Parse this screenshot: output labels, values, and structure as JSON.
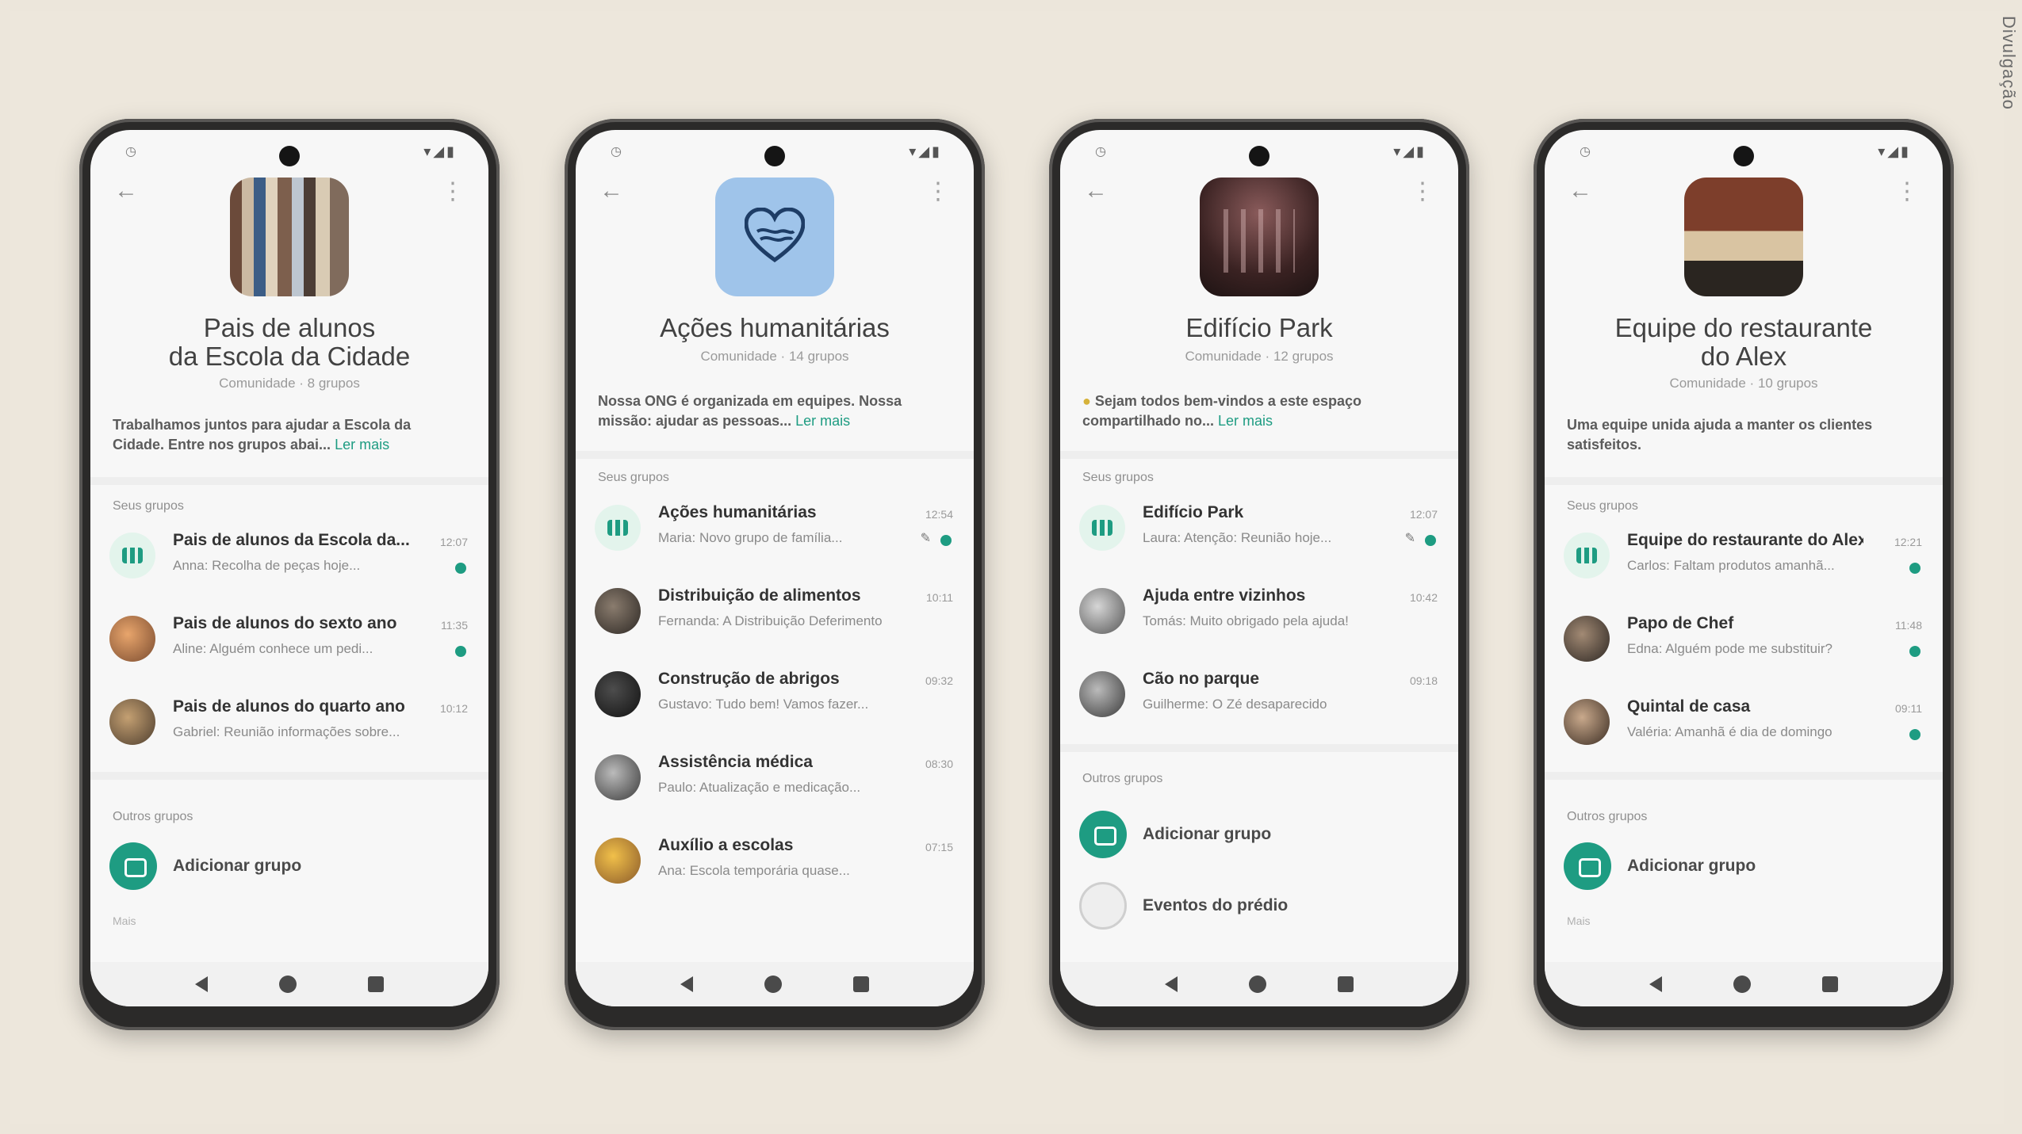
{
  "credit": "Divulgação",
  "accent_color": "#1e9c82",
  "phones": [
    {
      "title": "Pais de alunos\nda Escola da Cidade",
      "subtitle": "Comunidade · 8 grupos",
      "description": "Trabalhamos juntos para ajudar a Escola da Cidade. Entre nos grupos abai...",
      "more_link": "Ler mais",
      "groups_label": "Seus grupos",
      "groups": [
        {
          "name": "Pais de alunos da Escola da...",
          "preview": "Anna: Recolha de peças hoje...",
          "time": "12:07",
          "badge": true
        },
        {
          "name": "Pais de alunos do sexto ano",
          "preview": "Aline: Alguém conhece um pedi...",
          "time": "11:35",
          "badge": true
        },
        {
          "name": "Pais de alunos do quarto ano",
          "preview": "Gabriel: Reunião informações sobre...",
          "time": "10:12",
          "badge": false
        }
      ],
      "other_label": "Outros grupos",
      "add_group": "Adicionar grupo",
      "more_rows": "Mais"
    },
    {
      "title": "Ações humanitárias",
      "subtitle": "Comunidade · 14 grupos",
      "description": "Nossa ONG é organizada em equipes. Nossa missão: ajudar as pessoas...",
      "more_link": "Ler mais",
      "groups_label": "Seus grupos",
      "groups": [
        {
          "name": "Ações humanitárias",
          "preview": "Maria: Novo grupo de família...",
          "time": "12:54",
          "badge": true
        },
        {
          "name": "Distribuição de alimentos",
          "preview": "Fernanda: A Distribuição Deferimento",
          "time": "10:11",
          "badge": false
        },
        {
          "name": "Construção de abrigos",
          "preview": "Gustavo: Tudo bem! Vamos fazer...",
          "time": "09:32",
          "badge": false
        },
        {
          "name": "Assistência médica",
          "preview": "Paulo: Atualização e medicação...",
          "time": "08:30",
          "badge": false
        },
        {
          "name": "Auxílio a escolas",
          "preview": "Ana: Escola temporária quase...",
          "time": "07:15",
          "badge": false
        }
      ]
    },
    {
      "title": "Edifício Park",
      "subtitle": "Comunidade · 12 grupos",
      "description": "Sejam todos bem-vindos a este espaço compartilhado no...",
      "more_link": "Ler mais",
      "groups_label": "Seus grupos",
      "groups": [
        {
          "name": "Edifício Park",
          "preview": "Laura: Atenção: Reunião hoje...",
          "time": "12:07",
          "badge": true
        },
        {
          "name": "Ajuda entre vizinhos",
          "preview": "Tomás: Muito obrigado pela ajuda!",
          "time": "10:42",
          "badge": false
        },
        {
          "name": "Cão no parque",
          "preview": "Guilherme: O Zé desaparecido",
          "time": "09:18",
          "badge": false
        }
      ],
      "other_label": "Outros grupos",
      "add_group": "Adicionar grupo",
      "extra_group": "Eventos do prédio"
    },
    {
      "title": "Equipe do restaurante\ndo Alex",
      "subtitle": "Comunidade · 10 grupos",
      "description": "Uma equipe unida ajuda a manter os clientes satisfeitos.",
      "more_link": "",
      "groups_label": "Seus grupos",
      "groups": [
        {
          "name": "Equipe do restaurante do Alex",
          "preview": "Carlos: Faltam produtos amanhã...",
          "time": "12:21",
          "badge": true
        },
        {
          "name": "Papo de Chef",
          "preview": "Edna: Alguém pode me substituir?",
          "time": "11:48",
          "badge": true
        },
        {
          "name": "Quintal de casa",
          "preview": "Valéria: Amanhã é dia de domingo",
          "time": "09:11",
          "badge": true
        }
      ],
      "other_label": "Outros grupos",
      "add_group": "Adicionar grupo",
      "more_rows": "Mais"
    }
  ]
}
